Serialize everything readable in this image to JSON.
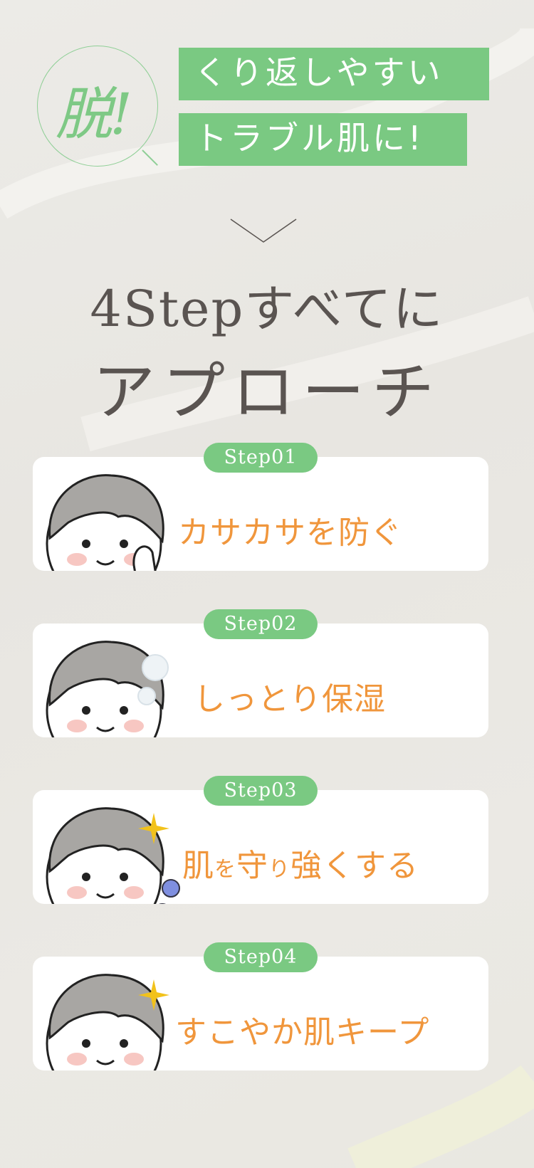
{
  "header": {
    "badge": "脱!",
    "headline_line1": "くり返しやすい",
    "headline_line2": "トラブル肌に!"
  },
  "title": {
    "line1": "4Stepすべてに",
    "line2": "アプローチ"
  },
  "steps": [
    {
      "pill": "Step01",
      "label": "カサカサを防ぐ",
      "icon": "hand-on-cheek"
    },
    {
      "pill": "Step02",
      "label": "しっとり保湿",
      "icon": "moisture-bubbles"
    },
    {
      "pill": "Step03",
      "label_parts": [
        "肌",
        "を",
        "守",
        "り",
        "強くする"
      ],
      "icon": "germ-guard"
    },
    {
      "pill": "Step04",
      "label": "すこやか肌キープ",
      "icon": "sparkle"
    }
  ],
  "colors": {
    "accent_green": "#7ac982",
    "label_orange": "#f0963c",
    "title_gray": "#5a5451",
    "background": "#ebe9e4"
  }
}
